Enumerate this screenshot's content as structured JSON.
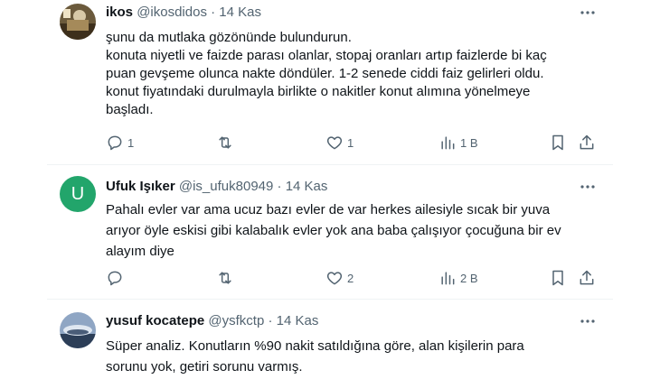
{
  "tweets": [
    {
      "name": "ikos",
      "handle": "@ikosdidos",
      "sep": "·",
      "date": "14 Kas",
      "avatar_icon": "profile-photo",
      "lines": [
        "şunu da mutlaka gözönünde bulundurun.",
        "konuta niyetli ve faizde parası olanlar, stopaj oranları artıp faizlerde bi kaç",
        "puan gevşeme olunca nakte döndüler. 1-2 senede ciddi faiz gelirleri oldu.",
        "konut fiyatındaki durulmayla birlikte o nakitler konut alımına yönelmeye",
        "başladı."
      ],
      "replies": "1",
      "retweets": "",
      "likes": "1",
      "views": "1 B"
    },
    {
      "name": "Ufuk Işıker",
      "handle": "@is_ufuk80949",
      "sep": "·",
      "date": "14 Kas",
      "avatar_letter": "U",
      "avatar_color": "#22a56b",
      "lines": [
        "Pahalı evler var ama ucuz bazı evler de var herkes  ailesiyle  sıcak  bir yuva",
        "arıyor öyle eskisi gibi kalabalık evler yok ana baba çalışıyor çocuğuna bir ev",
        "alayım diye"
      ],
      "replies": "",
      "retweets": "",
      "likes": "2",
      "views": "2 B"
    },
    {
      "name": "yusuf kocatepe",
      "handle": "@ysfkctp",
      "sep": "·",
      "date": "14 Kas",
      "avatar_icon": "profile-photo",
      "lines": [
        "Süper analiz. Konutların %90 nakit satıldığına göre, alan kişilerin para",
        "sorunu yok, getiri sorunu varmış."
      ]
    }
  ],
  "colors": {
    "text": "#0f1419",
    "secondary": "#536471",
    "divider": "#eff3f4"
  }
}
